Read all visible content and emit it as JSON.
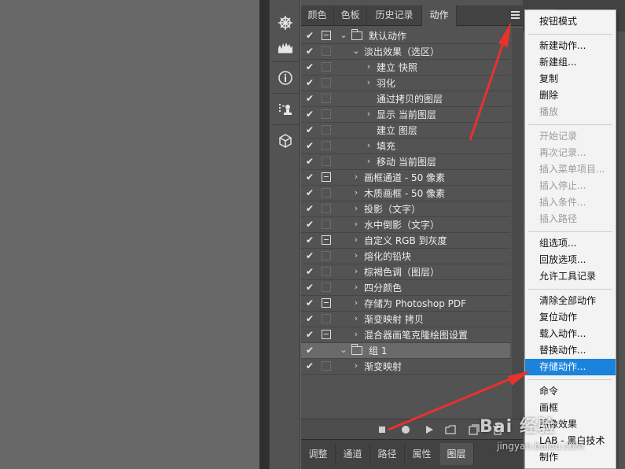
{
  "toolbar": {
    "tools": [
      {
        "icon": "navigator-wheel-icon"
      },
      {
        "icon": "histogram-icon"
      },
      {
        "icon": "info-icon"
      },
      {
        "icon": "clone-source-icon"
      },
      {
        "icon": "3d-cube-icon"
      }
    ]
  },
  "panel": {
    "tabs": [
      "颜色",
      "色板",
      "历史记录",
      "动作"
    ],
    "active_tab": "动作",
    "rows": [
      {
        "label": "默认动作",
        "type": "set",
        "dialog": true,
        "expanded": true
      },
      {
        "label": "淡出效果（选区）",
        "type": "action",
        "dialog": false,
        "expanded": true
      },
      {
        "label": "建立 快照",
        "type": "step",
        "dialog": false,
        "expandable": true
      },
      {
        "label": "羽化",
        "type": "step",
        "dialog": false,
        "expandable": true
      },
      {
        "label": "通过拷贝的图层",
        "type": "step",
        "dialog": false,
        "expandable": false
      },
      {
        "label": "显示 当前图层",
        "type": "step",
        "dialog": false,
        "expandable": true
      },
      {
        "label": "建立 图层",
        "type": "step",
        "dialog": false,
        "expandable": false
      },
      {
        "label": "填充",
        "type": "step",
        "dialog": false,
        "expandable": true
      },
      {
        "label": "移动 当前图层",
        "type": "step",
        "dialog": false,
        "expandable": true
      },
      {
        "label": "画框通道 - 50 像素",
        "type": "action",
        "dialog": true,
        "expandable": true
      },
      {
        "label": "木质画框 - 50 像素",
        "type": "action",
        "dialog": false,
        "expandable": true
      },
      {
        "label": "投影（文字）",
        "type": "action",
        "dialog": false,
        "expandable": true
      },
      {
        "label": "水中倒影（文字）",
        "type": "action",
        "dialog": false,
        "expandable": true
      },
      {
        "label": "自定义 RGB 到灰度",
        "type": "action",
        "dialog": true,
        "expandable": true
      },
      {
        "label": "熔化的铅块",
        "type": "action",
        "dialog": false,
        "expandable": true
      },
      {
        "label": "棕褐色调（图层）",
        "type": "action",
        "dialog": false,
        "expandable": true
      },
      {
        "label": "四分颜色",
        "type": "action",
        "dialog": false,
        "expandable": true
      },
      {
        "label": "存储为 Photoshop PDF",
        "type": "action",
        "dialog": true,
        "expandable": true
      },
      {
        "label": "渐变映射 拷贝",
        "type": "action",
        "dialog": false,
        "expandable": true
      },
      {
        "label": "混合器画笔克隆绘图设置",
        "type": "action",
        "dialog": true,
        "expandable": true
      },
      {
        "label": "组 1",
        "type": "set",
        "dialog": false,
        "expanded": true,
        "selected": true
      },
      {
        "label": "渐变映射",
        "type": "action",
        "dialog": false,
        "expandable": true
      }
    ],
    "check_mark": "✔",
    "bottom_actions": [
      "stop-icon",
      "record-icon",
      "play-icon",
      "new-set-icon",
      "new-action-icon",
      "delete-icon"
    ],
    "lower_tabs": [
      "调整",
      "通道",
      "路径",
      "属性",
      "图层"
    ],
    "lower_active": "图层"
  },
  "menu": {
    "groups": [
      [
        {
          "label": "按钮模式",
          "enabled": true
        }
      ],
      [
        {
          "label": "新建动作...",
          "enabled": true
        },
        {
          "label": "新建组...",
          "enabled": true
        },
        {
          "label": "复制",
          "enabled": true
        },
        {
          "label": "删除",
          "enabled": true
        },
        {
          "label": "播放",
          "enabled": false
        }
      ],
      [
        {
          "label": "开始记录",
          "enabled": false
        },
        {
          "label": "再次记录...",
          "enabled": false
        },
        {
          "label": "插入菜单项目...",
          "enabled": false
        },
        {
          "label": "插入停止...",
          "enabled": false
        },
        {
          "label": "插入条件...",
          "enabled": false
        },
        {
          "label": "插入路径",
          "enabled": false
        }
      ],
      [
        {
          "label": "组选项...",
          "enabled": true
        },
        {
          "label": "回放选项...",
          "enabled": true
        },
        {
          "label": "允许工具记录",
          "enabled": true
        }
      ],
      [
        {
          "label": "清除全部动作",
          "enabled": true
        },
        {
          "label": "复位动作",
          "enabled": true
        },
        {
          "label": "载入动作...",
          "enabled": true
        },
        {
          "label": "替换动作...",
          "enabled": true
        },
        {
          "label": "存储动作...",
          "enabled": true,
          "highlighted": true
        }
      ],
      [
        {
          "label": "命令",
          "enabled": true
        },
        {
          "label": "画框",
          "enabled": true
        },
        {
          "label": "图像效果",
          "enabled": true
        },
        {
          "label": "LAB - 黑白技术",
          "enabled": true
        },
        {
          "label": "制作",
          "enabled": true
        }
      ]
    ]
  },
  "watermark": {
    "logo": "Bai 经验",
    "url": "jingyan.baidu.com"
  },
  "colors": {
    "canvas": "#686868",
    "panel": "#535353",
    "menu_bg": "#f3f3f3",
    "menu_highlight": "#1c83dc",
    "arrow_red": "#e8322d"
  }
}
